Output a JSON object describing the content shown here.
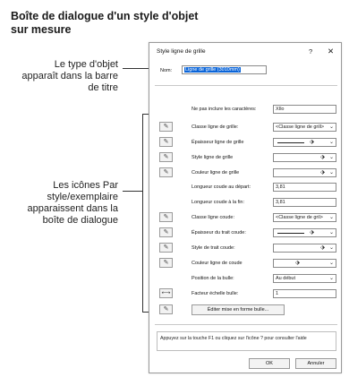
{
  "title": "Boîte de dialogue d'un style d'objet sur mesure",
  "callouts": {
    "object_type": "Le type d'objet apparaît dans la barre de titre",
    "icons": "Les icônes Par style/exemplaire apparaissent dans la boîte de dialogue"
  },
  "dialog": {
    "title": "Style ligne de grille",
    "help_symbol": "?",
    "close_symbol": "✕",
    "name_label": "Nom:",
    "name_value": "Ligne de grille (3010mm)",
    "no_chars_label": "Ne pas inclure les caractères:",
    "no_chars_value": "XIlo",
    "rows": [
      {
        "label": "Classe ligne de grille:",
        "value": "<Classe ligne de grill>",
        "kind": "text"
      },
      {
        "label": "Épaisseur ligne de grille",
        "value": "",
        "kind": "line"
      },
      {
        "label": "Style ligne de grille",
        "value": "",
        "kind": "bucket"
      },
      {
        "label": "Couleur ligne de grille",
        "value": "",
        "kind": "bucket"
      },
      {
        "label": "Classe ligne coude:",
        "value": "<Classe ligne de gril>",
        "kind": "text"
      },
      {
        "label": "Épaisseur du trait coude:",
        "value": "",
        "kind": "line"
      },
      {
        "label": "Style de trait coude:",
        "value": "",
        "kind": "bucket"
      },
      {
        "label": "Couleur ligne de coude",
        "value": "",
        "kind": "bucket"
      },
      {
        "label": "Position de la bulle:",
        "value": "Au début",
        "kind": "text"
      }
    ],
    "start_length_label": "Longueur coude au départ:",
    "start_length_value": "3,81",
    "end_length_label": "Longueur coude à la fin:",
    "end_length_value": "3,81",
    "scale_label": "Facteur échelle bulle:",
    "scale_value": "1",
    "edit_button": "Éditer mise en forme bulle...",
    "help_text": "Appuyez sur la touche F1 ou cliquez sur l'icône ? pour consulter l'aide",
    "ok": "OK",
    "cancel": "Annuler",
    "chevron": "⌄",
    "bucket_icon": "⬗",
    "style_icon": "✎",
    "scale_icon": "⟷"
  }
}
